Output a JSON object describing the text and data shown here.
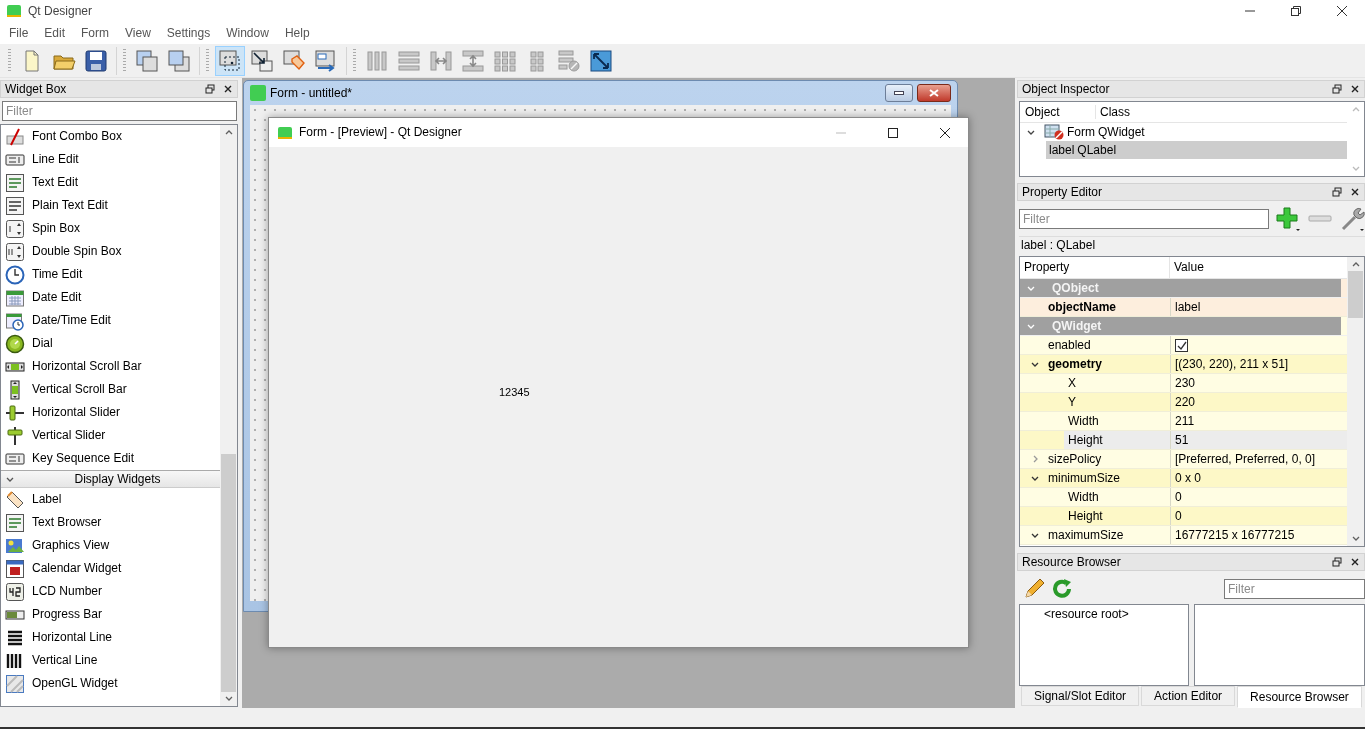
{
  "window": {
    "title": "Qt Designer"
  },
  "menu": [
    "File",
    "Edit",
    "Form",
    "View",
    "Settings",
    "Window",
    "Help"
  ],
  "toolbar": {
    "groups": [
      {
        "buttons": [
          {
            "disabled": false
          },
          {
            "disabled": false
          },
          {
            "disabled": false
          }
        ]
      },
      {
        "buttons": [
          {
            "disabled": false
          },
          {
            "disabled": false
          }
        ]
      },
      {
        "buttons": [
          {
            "selected": true
          },
          {
            "selected": false
          },
          {
            "selected": false
          },
          {
            "selected": false
          }
        ]
      },
      {
        "buttons": [
          {
            "disabled": true
          },
          {
            "disabled": true
          },
          {
            "disabled": true
          },
          {
            "disabled": true
          },
          {
            "disabled": true
          },
          {
            "disabled": true
          },
          {
            "disabled": true
          },
          {
            "disabled": false
          }
        ]
      }
    ]
  },
  "widget_box": {
    "title": "Widget Box",
    "filter": {
      "placeholder": "Filter"
    },
    "items": [
      {
        "kind": "widget",
        "label": "Font Combo Box"
      },
      {
        "kind": "widget",
        "label": "Line Edit"
      },
      {
        "kind": "widget",
        "label": "Text Edit"
      },
      {
        "kind": "widget",
        "label": "Plain Text Edit"
      },
      {
        "kind": "widget",
        "label": "Spin Box"
      },
      {
        "kind": "widget",
        "label": "Double Spin Box"
      },
      {
        "kind": "widget",
        "label": "Time Edit"
      },
      {
        "kind": "widget",
        "label": "Date Edit"
      },
      {
        "kind": "widget",
        "label": "Date/Time Edit"
      },
      {
        "kind": "widget",
        "label": "Dial"
      },
      {
        "kind": "widget",
        "label": "Horizontal Scroll Bar"
      },
      {
        "kind": "widget",
        "label": "Vertical Scroll Bar"
      },
      {
        "kind": "widget",
        "label": "Horizontal Slider"
      },
      {
        "kind": "widget",
        "label": "Vertical Slider"
      },
      {
        "kind": "widget",
        "label": "Key Sequence Edit"
      },
      {
        "kind": "category",
        "label": "Display Widgets",
        "expanded": true
      },
      {
        "kind": "widget",
        "label": "Label"
      },
      {
        "kind": "widget",
        "label": "Text Browser"
      },
      {
        "kind": "widget",
        "label": "Graphics View"
      },
      {
        "kind": "widget",
        "label": "Calendar Widget"
      },
      {
        "kind": "widget",
        "label": "LCD Number"
      },
      {
        "kind": "widget",
        "label": "Progress Bar"
      },
      {
        "kind": "widget",
        "label": "Horizontal Line"
      },
      {
        "kind": "widget",
        "label": "Vertical Line"
      },
      {
        "kind": "widget",
        "label": "OpenGL Widget"
      }
    ]
  },
  "form_window": {
    "title": "Form - untitled*"
  },
  "preview_window": {
    "title": "Form - [Preview] - Qt Designer",
    "label": "12345"
  },
  "object_inspector": {
    "title": "Object Inspector",
    "columns": [
      "Object",
      "Class"
    ],
    "tree": [
      {
        "object": "Form",
        "class": "QWidget",
        "expanded": true,
        "selected": false,
        "children": [
          {
            "object": "label",
            "class": "QLabel",
            "selected": true
          }
        ]
      }
    ]
  },
  "property_editor": {
    "title": "Property Editor",
    "filter": {
      "placeholder": "Filter"
    },
    "object_label": "label : QLabel",
    "columns": [
      "Property",
      "Value"
    ],
    "groups": [
      {
        "name": "QObject",
        "expanded": true,
        "color": "#fdeedd",
        "properties": [
          {
            "kind": "text",
            "name": "objectName",
            "value": "label",
            "modified": true,
            "selected": false
          }
        ]
      },
      {
        "name": "QWidget",
        "expanded": true,
        "color": "#fffde3",
        "properties": [
          {
            "kind": "checkbox",
            "name": "enabled",
            "checked": true,
            "modified": false,
            "selected": false
          },
          {
            "kind": "text",
            "name": "geometry",
            "value": "[(230, 220), 211 x 51]",
            "modified": true,
            "selected": false,
            "expanded": true,
            "children": [
              {
                "kind": "text",
                "name": "X",
                "value": "230",
                "modified": false,
                "selected": false
              },
              {
                "kind": "text",
                "name": "Y",
                "value": "220",
                "modified": false,
                "selected": false
              },
              {
                "kind": "text",
                "name": "Width",
                "value": "211",
                "modified": false,
                "selected": false
              },
              {
                "kind": "text",
                "name": "Height",
                "value": "51",
                "modified": false,
                "selected": true
              }
            ]
          },
          {
            "kind": "text",
            "name": "sizePolicy",
            "value": "[Preferred, Preferred, 0, 0]",
            "modified": false,
            "selected": false,
            "expanded": false
          },
          {
            "kind": "text",
            "name": "minimumSize",
            "value": "0 x 0",
            "modified": false,
            "selected": false,
            "expanded": true,
            "children": [
              {
                "kind": "text",
                "name": "Width",
                "value": "0",
                "modified": false,
                "selected": false
              },
              {
                "kind": "text",
                "name": "Height",
                "value": "0",
                "modified": false,
                "selected": false
              }
            ]
          },
          {
            "kind": "text",
            "name": "maximumSize",
            "value": "16777215 x 16777215",
            "modified": false,
            "selected": false,
            "expanded": true
          }
        ]
      }
    ]
  },
  "resource_browser": {
    "title": "Resource Browser",
    "filter": {
      "placeholder": "Filter"
    },
    "tree": [
      "<resource root>"
    ]
  },
  "bottom_tabs": [
    {
      "label": "Signal/Slot Editor",
      "selected": false
    },
    {
      "label": "Action Editor",
      "selected": false
    },
    {
      "label": "Resource Browser",
      "selected": true
    }
  ]
}
